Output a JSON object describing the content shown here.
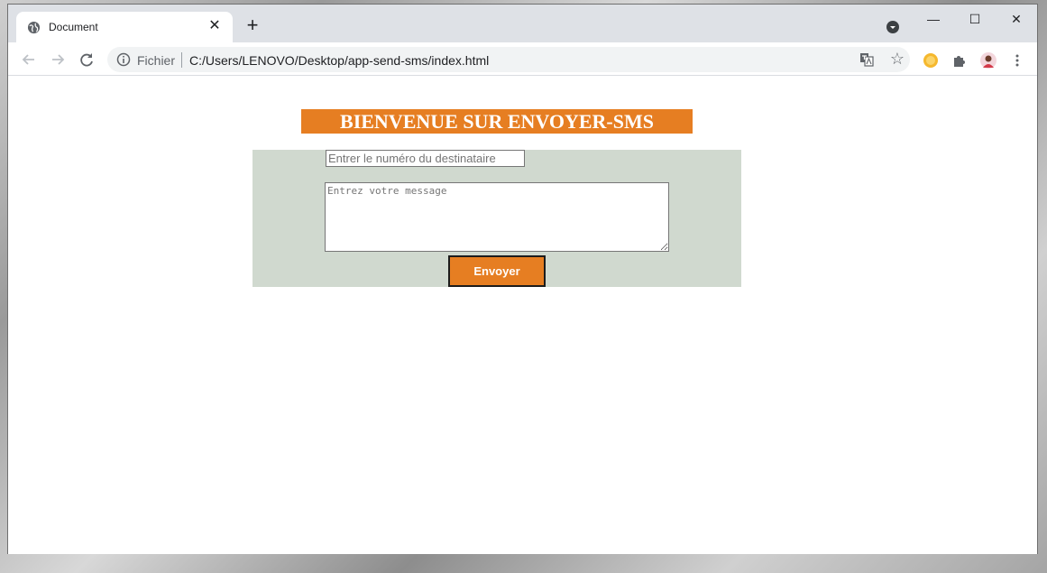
{
  "browser": {
    "tab_title": "Document",
    "new_tab_symbol": "+",
    "close_tab_symbol": "✕",
    "scheme_label": "Fichier",
    "url": "C:/Users/LENOVO/Desktop/app-send-sms/index.html",
    "window_controls": {
      "minimize": "—",
      "maximize": "☐",
      "close": "✕"
    },
    "icons": [
      "globe-icon",
      "back-icon",
      "forward-icon",
      "reload-icon",
      "info-icon",
      "translate-icon",
      "star-icon",
      "orange-extension-icon",
      "puzzle-icon",
      "avatar",
      "menu-icon"
    ]
  },
  "page": {
    "title": "BIENVENUE SUR ENVOYER-SMS",
    "phone_placeholder": "Entrer le numéro du destinataire",
    "message_placeholder": "Entrez votre message",
    "send_label": "Envoyer"
  },
  "colors": {
    "accent": "#e67e22",
    "form_bg": "#d0d9cf"
  }
}
